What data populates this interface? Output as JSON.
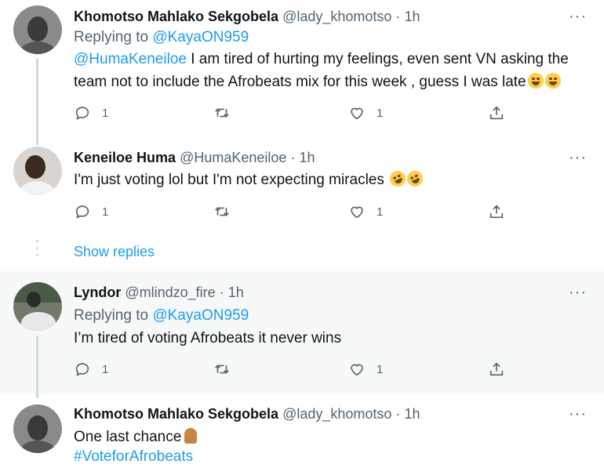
{
  "tweets": [
    {
      "name": "Khomotso Mahlako Sekgobela",
      "handle": "@lady_khomotso",
      "dot": "·",
      "time": "1h",
      "replying_prefix": "Replying to",
      "replying_to": "@KayaON959",
      "mention": "@HumaKeneiloe",
      "text_line1": " I am tired of hurting my feelings, even sent VN asking the",
      "text_line2": "team not to include the Afrobeats mix for this week , guess I was late",
      "emoji": "face-with-tears-of-joy",
      "replies": "1",
      "likes": "1"
    },
    {
      "name": "Keneiloe Huma",
      "handle": "@HumaKeneiloe",
      "dot": "·",
      "time": "1h",
      "text": "I'm just voting lol but I'm not expecting miracles",
      "emoji": "rolling-on-floor-laughing",
      "replies": "1",
      "likes": "1"
    },
    {
      "name": "Lyndor",
      "handle": "@mlindzo_fire",
      "dot": "·",
      "time": "1h",
      "replying_prefix": "Replying to",
      "replying_to": "@KayaON959",
      "text": "I’m tired of voting Afrobeats it never wins",
      "replies": "1",
      "likes": "1"
    },
    {
      "name": "Khomotso Mahlako Sekgobela",
      "handle": "@lady_khomotso",
      "dot": "·",
      "time": "1h",
      "text": "One last chance",
      "emoji": "folded-hands",
      "hashtag": "#VoteforAfrobeats"
    }
  ],
  "show_replies": "Show replies",
  "more_label": "···",
  "colors": {
    "link": "#1d9bf0",
    "muted": "#536471",
    "highlight_bg": "#f7f9f9",
    "thread_line": "#cfd9de"
  },
  "icons": [
    "reply-icon",
    "retweet-icon",
    "like-icon",
    "share-icon",
    "more-icon"
  ]
}
